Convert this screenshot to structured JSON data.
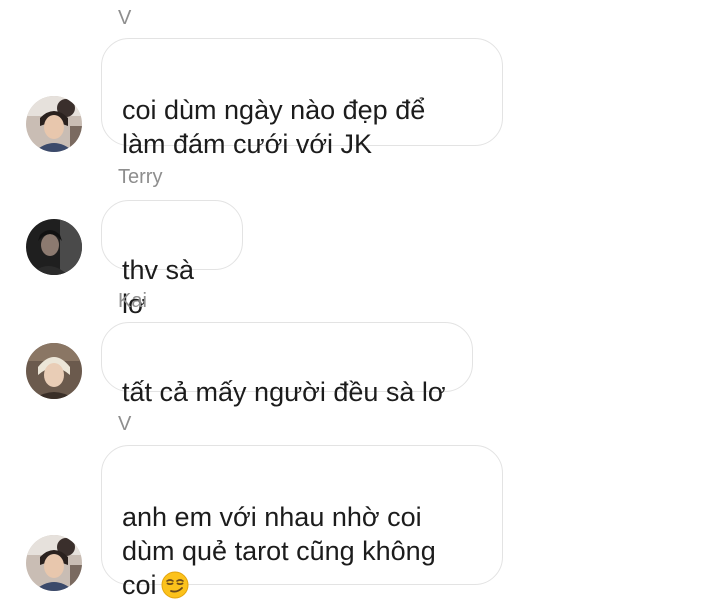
{
  "messages": [
    {
      "sender": "V",
      "text": "coi dùm ngày nào đẹp để\nlàm đám cưới với JK",
      "avatar": "v-avatar"
    },
    {
      "sender": "Terry",
      "text": "thv sà lơ",
      "avatar": "terry-avatar"
    },
    {
      "sender": "Kai",
      "text": "tất cả mấy người đều sà lơ",
      "avatar": "kai-avatar"
    },
    {
      "sender": "V",
      "text": "anh em với nhau nhờ coi\ndùm quẻ tarot cũng không\ncoi",
      "emoji": "smirking-face",
      "avatar": "v-avatar"
    }
  ]
}
